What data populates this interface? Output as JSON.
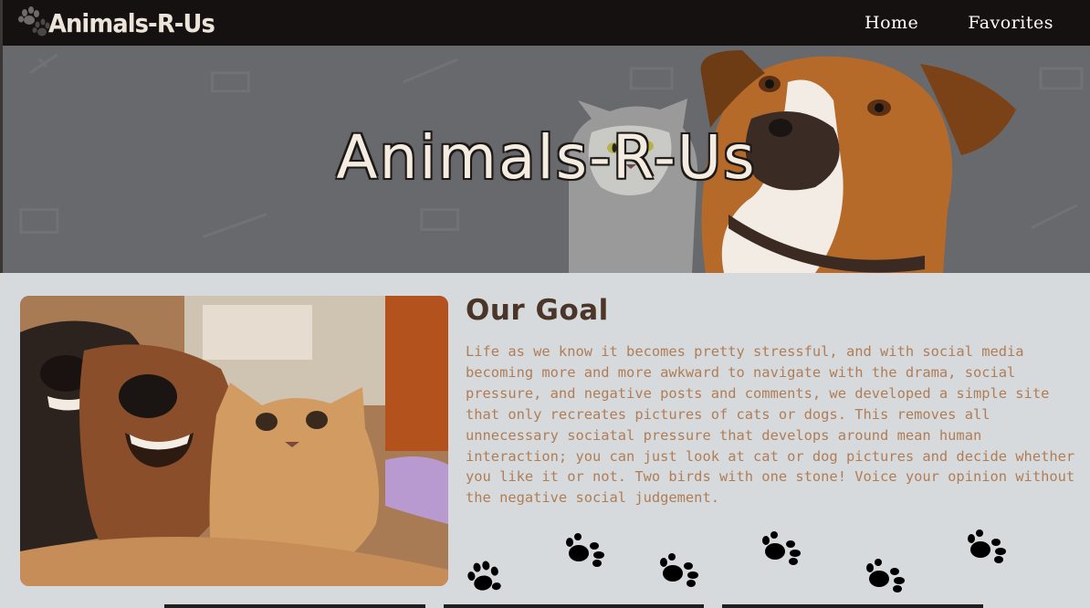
{
  "navbar": {
    "brand": "Animals-R-Us",
    "links": [
      "Home",
      "Favorites"
    ]
  },
  "hero": {
    "title": "Animals-R-Us"
  },
  "goal": {
    "title": "Our Goal",
    "text": "Life as we know it becomes pretty stressful, and with social media becoming more and more awkward to navigate with the drama, social pressure, and negative posts and comments, we developed a simple site that only recreates pictures of cats or dogs. This removes all unnecessary sociatal pressure that develops around mean human interaction; you can just look at cat or dog pictures and decide whether you like it or not. Two birds with one stone! Voice your opinion without the negative social judgement."
  },
  "colors": {
    "navbar": "#141110",
    "page_background": "#d6dadd",
    "goal_title": "#4a3528",
    "goal_text": "#b07d56"
  },
  "icons": [
    "paw-print-icon"
  ]
}
